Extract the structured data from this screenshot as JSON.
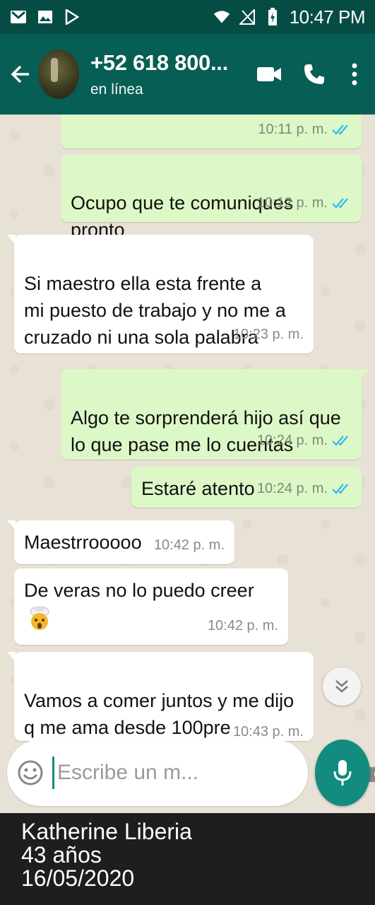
{
  "status_bar": {
    "time": "10:47 PM",
    "icons": [
      "gmail-icon",
      "gallery-icon",
      "play-store-icon",
      "wifi-icon",
      "no-signal-icon",
      "battery-charging-icon"
    ]
  },
  "header": {
    "contact_name": "+52 618 800...",
    "contact_status": "en línea",
    "icons": [
      "back-arrow-icon",
      "video-call-icon",
      "phone-call-icon",
      "more-options-icon"
    ]
  },
  "messages": [
    {
      "direction": "out",
      "text": "",
      "time": "10:11 p. m.",
      "read": true
    },
    {
      "direction": "out",
      "text": "Ocupo que te comuniques pronto\ncon urgencia",
      "time": "10:12 p. m.",
      "read": true
    },
    {
      "direction": "in",
      "text": "Si maestro ella esta frente a\nmi puesto de trabajo y no me a\ncruzado ni una sola palabra",
      "time": "10:23 p. m."
    },
    {
      "direction": "out",
      "text": "Algo te sorprenderá hijo así que\nlo que pase me lo cuentas",
      "time": "10:24 p. m.",
      "read": true
    },
    {
      "direction": "out",
      "text": "Estaré atento",
      "time": "10:24 p. m.",
      "read": true
    },
    {
      "direction": "in",
      "text": "Maestrrooooo",
      "time": "10:42 p. m."
    },
    {
      "direction": "in",
      "text": "De veras no lo puedo creer",
      "emoji": "exploding-head-cowboy-emoji",
      "time": "10:42 p. m."
    },
    {
      "direction": "in",
      "text": "Vamos a comer juntos y me dijo\nq me ama desde 100pre",
      "time": "10:43 p. m."
    }
  ],
  "input": {
    "placeholder": "Escribe un m...",
    "value": ""
  },
  "caption": {
    "line1": "Katherine Liberia",
    "line2": "43 años",
    "line3": "16/05/2020"
  },
  "colors": {
    "header": "#075e54",
    "status_bar": "#054d44",
    "outgoing_bubble": "#dcf8c6",
    "incoming_bubble": "#ffffff",
    "chat_bg": "#e8e1d6",
    "read_ticks": "#34b7f1",
    "accent": "#128c7e"
  }
}
